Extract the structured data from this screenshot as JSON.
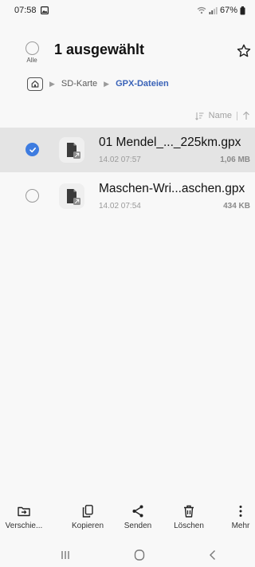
{
  "status_bar": {
    "time": "07:58",
    "battery": "67%"
  },
  "header": {
    "select_all_label": "Alle",
    "title": "1 ausgewählt"
  },
  "breadcrumb": {
    "items": [
      "SD-Karte",
      "GPX-Dateien"
    ]
  },
  "sort": {
    "label": "Name"
  },
  "files": [
    {
      "name": "01 Mendel_..._225km.gpx",
      "date": "14.02 07:57",
      "size": "1,06 MB",
      "selected": true
    },
    {
      "name": "Maschen-Wri...aschen.gpx",
      "date": "14.02 07:54",
      "size": "434 KB",
      "selected": false
    }
  ],
  "actions": {
    "move": "Verschie...",
    "copy": "Kopieren",
    "share": "Senden",
    "delete": "Löschen",
    "more": "Mehr"
  },
  "colors": {
    "accent": "#3e7ce0",
    "breadcrumb_active": "#3a63b8",
    "selected_row": "#e4e4e4",
    "background": "#f8f8f8"
  },
  "icons": [
    "image-icon",
    "wifi-icon",
    "signal-icon",
    "battery-icon",
    "star-icon",
    "home-icon",
    "sort-icon",
    "arrow-up-icon",
    "check-icon",
    "file-icon",
    "move-icon",
    "copy-icon",
    "share-icon",
    "delete-icon",
    "more-icon",
    "recent-apps-icon",
    "home-nav-icon",
    "back-icon"
  ]
}
